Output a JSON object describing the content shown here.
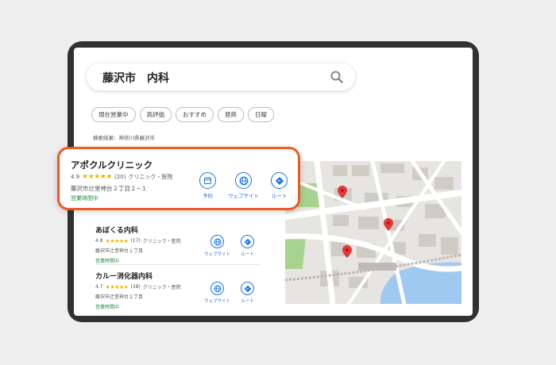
{
  "search": {
    "query": "藤沢市　内科"
  },
  "filters": [
    "現在営業中",
    "高評価",
    "おすすめ",
    "発熱",
    "日曜"
  ],
  "results_label": "検索結果：神奈川県藤沢市",
  "actions": {
    "reserve": "予約",
    "website": "ウェブサイト",
    "route": "ルート"
  },
  "featured": {
    "name": "アポクルクリニック",
    "rating": "4.9",
    "stars": "★★★★★",
    "reviews": "(20)",
    "category": "クリニック・医院",
    "address": "藤沢市辻堂神台２丁目２−１",
    "status": "営業時間中"
  },
  "results": [
    {
      "name": "あぼくる内科",
      "rating": "4.8",
      "stars": "★★★★★",
      "reviews": "(17)",
      "category": "クリニック・医院",
      "address": "藤沢市辻堂神台１丁目",
      "status": "営業時間中"
    },
    {
      "name": "カルー消化器内科",
      "rating": "4.7",
      "stars": "★★★★★",
      "reviews": "(38)",
      "category": "クリニック・医院",
      "address": "藤沢市辻堂神台２丁目",
      "status": "営業時間中"
    }
  ],
  "colors": {
    "accent": "#1a73e8",
    "highlight": "#ee5a24",
    "open": "#1e8e3e",
    "star": "#f3b400",
    "pin": "#e53935"
  }
}
